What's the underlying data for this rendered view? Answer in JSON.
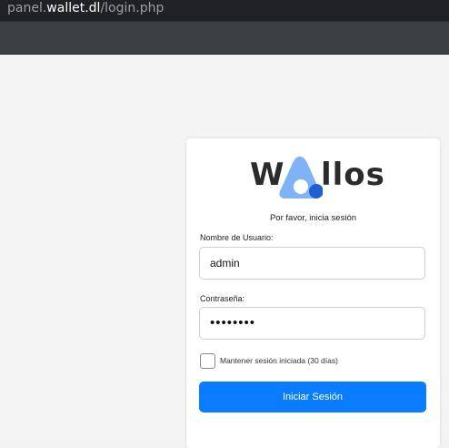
{
  "browser": {
    "url_prefix": "panel.",
    "url_host": "wallet.dl",
    "url_path": "/login.php"
  },
  "login": {
    "logo_left": "W",
    "logo_right": "llos",
    "subtitle": "Por favor, inicia sesión",
    "username_label": "Nombre de Usuario:",
    "username_value": "admin",
    "password_label": "Contraseña:",
    "password_value": "••••••••",
    "remember_label": "Mantener sesión iniciada (30 días)",
    "remember_checked": false,
    "submit_label": "Iniciar Sesión"
  },
  "colors": {
    "accent": "#0a7cff",
    "logo_light_blue": "#7fb3f5",
    "logo_dark_blue": "#1f5fd0"
  }
}
